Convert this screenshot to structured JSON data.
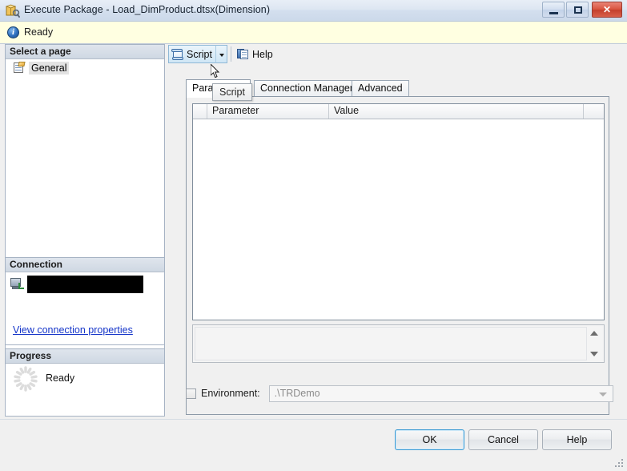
{
  "window": {
    "title": "Execute Package - Load_DimProduct.dtsx(Dimension)",
    "icon": "package-wrench-icon",
    "controls": {
      "minimize": "Minimize",
      "maximize": "Maximize",
      "close": "Close",
      "close_glyph": "✕"
    }
  },
  "status_bar": {
    "icon": "info-icon",
    "text": "Ready"
  },
  "left_pane": {
    "select_page_header": "Select a page",
    "pages": [
      {
        "label": "General",
        "icon": "page-icon",
        "selected": true
      }
    ],
    "connection": {
      "header": "Connection",
      "server_icon": "server-connection-icon",
      "server_name": "",
      "view_properties_link": "View connection properties"
    },
    "progress": {
      "header": "Progress",
      "spinner_icon": "progress-spinner-icon",
      "status": "Ready"
    }
  },
  "toolbar": {
    "script_label": "Script",
    "script_icon": "script-scroll-icon",
    "script_dropdown_icon": "chevron-down-icon",
    "help_label": "Help",
    "help_icon": "help-book-icon"
  },
  "tooltip": {
    "text": "Script"
  },
  "tabs": [
    {
      "label": "Parameters",
      "active": true
    },
    {
      "label": "Connection Managers",
      "active": false
    },
    {
      "label": "Advanced",
      "active": false
    }
  ],
  "grid": {
    "columns": [
      "",
      "Parameter",
      "Value",
      ""
    ],
    "rows": []
  },
  "environment": {
    "checkbox_label": "Environment:",
    "checked": false,
    "selected_value": ".\\TRDemo",
    "dropdown_icon": "chevron-down-icon"
  },
  "footer": {
    "ok_label": "OK",
    "cancel_label": "Cancel",
    "help_label": "Help",
    "resize_grip": "resize-grip"
  },
  "colors": {
    "status_bar_bg": "#FFFFE1",
    "link": "#1535C9",
    "default_button_border": "#3D9BD4",
    "close_button": "#C33F2C",
    "titlebar": "#D3DFEE"
  }
}
